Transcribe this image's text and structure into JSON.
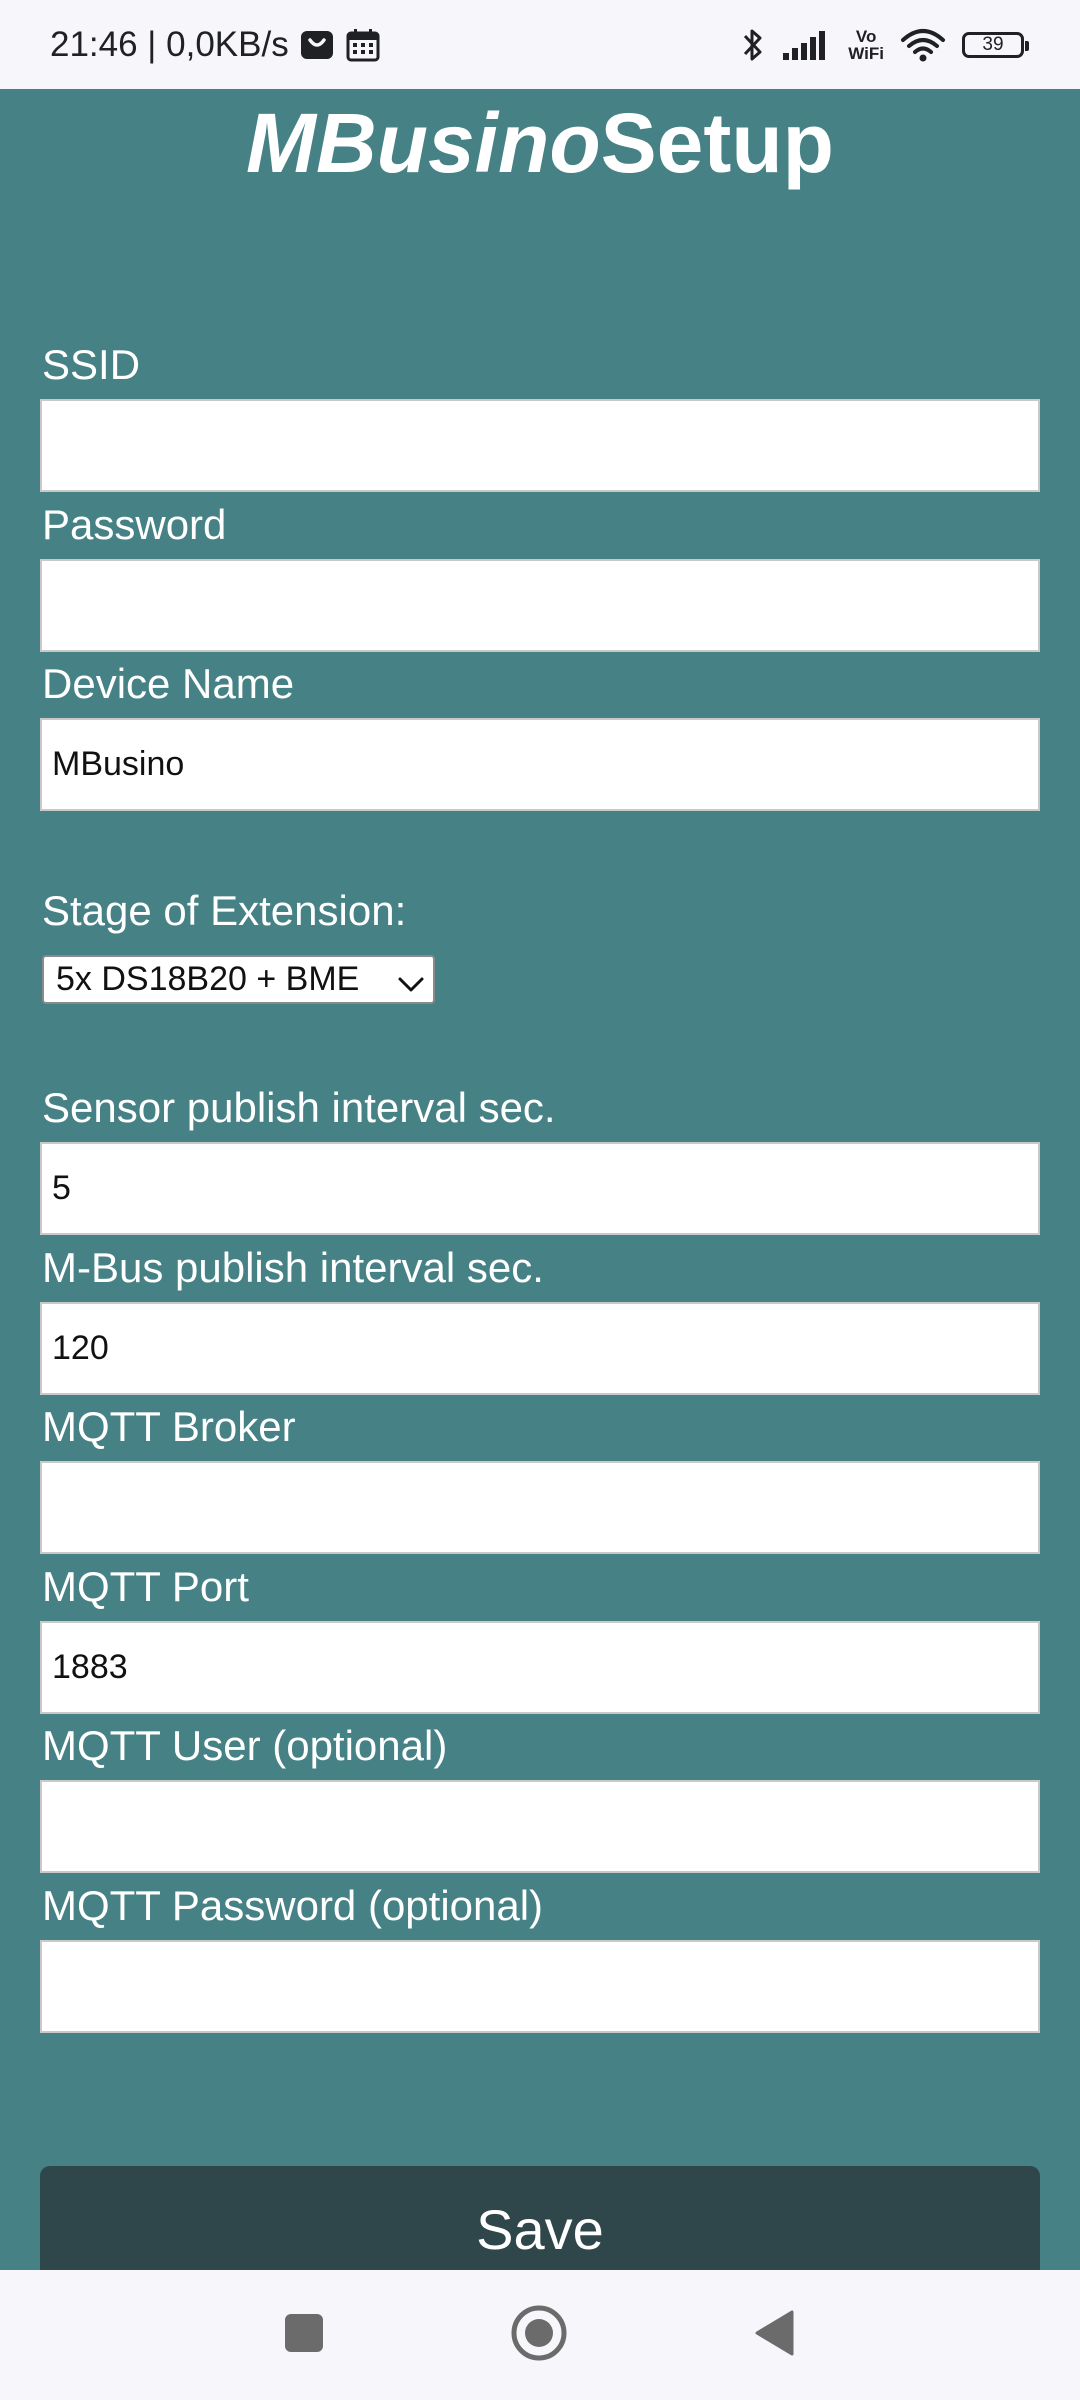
{
  "status_bar": {
    "time_speed": "21:46 | 0,0KB/s",
    "vo": "Vo",
    "wifi_label": "WiFi",
    "battery": "39",
    "icons": [
      "shop-bag-icon",
      "calendar-icon",
      "bluetooth-icon",
      "signal-icon",
      "wifi-icon",
      "battery-icon"
    ]
  },
  "header": {
    "title_italic": "MBusino",
    "title_bold": "Setup"
  },
  "form": {
    "ssid": {
      "label": "SSID",
      "value": ""
    },
    "password": {
      "label": "Password",
      "value": ""
    },
    "device_name": {
      "label": "Device Name",
      "value": "MBusino"
    },
    "stage": {
      "label": "Stage of Extension:",
      "selected": "5x DS18B20 + BME"
    },
    "sensor_interval": {
      "label": "Sensor publish interval sec.",
      "value": "5"
    },
    "mbus_interval": {
      "label": "M-Bus publish interval sec.",
      "value": "120"
    },
    "mqtt_broker": {
      "label": "MQTT Broker",
      "value": ""
    },
    "mqtt_port": {
      "label": "MQTT Port",
      "value": "1883"
    },
    "mqtt_user": {
      "label": "MQTT User (optional)",
      "value": ""
    },
    "mqtt_password": {
      "label": "MQTT Password (optional)",
      "value": ""
    },
    "save_label": "Save"
  },
  "colors": {
    "page_background": "#468285",
    "save_button": "#2f474a",
    "system_bars": "#f6f6fb"
  },
  "nav_bar": {
    "icons": [
      "recents-icon",
      "home-icon",
      "back-icon"
    ]
  }
}
